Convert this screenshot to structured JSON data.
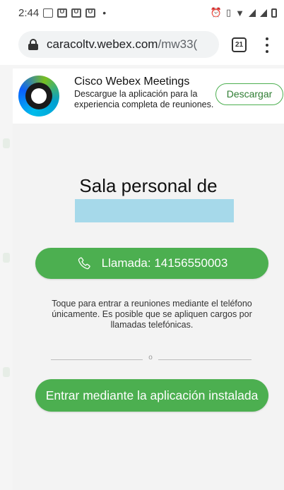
{
  "status_bar": {
    "time": "2:44",
    "notification_dot": "•",
    "icons": [
      "document-icon",
      "u-app-icon",
      "u-app-icon",
      "u-app-icon",
      "alarm-icon",
      "vibrate-icon",
      "wifi-icon",
      "signal-icon",
      "signal-icon",
      "battery-icon"
    ]
  },
  "browser": {
    "url_host": "caracoltv.webex.com",
    "url_path": "/mw33(",
    "tab_count": "21"
  },
  "banner": {
    "title": "Cisco Webex Meetings",
    "description": "Descargue la aplicación para la experiencia completa de reuniones.",
    "download_label": "Descargar"
  },
  "room": {
    "title": "Sala personal de",
    "call_button_label": "Llamada: 14156550003",
    "call_note": "Toque para entrar a reuniones mediante el teléfono únicamente. Es posible que se apliquen cargos por llamadas telefónicas.",
    "separator_text": "o",
    "app_button_label": "Entrar mediante la aplicación instalada"
  },
  "colors": {
    "accent_green": "#4caf50",
    "redaction_blue": "#a6d9ea"
  }
}
